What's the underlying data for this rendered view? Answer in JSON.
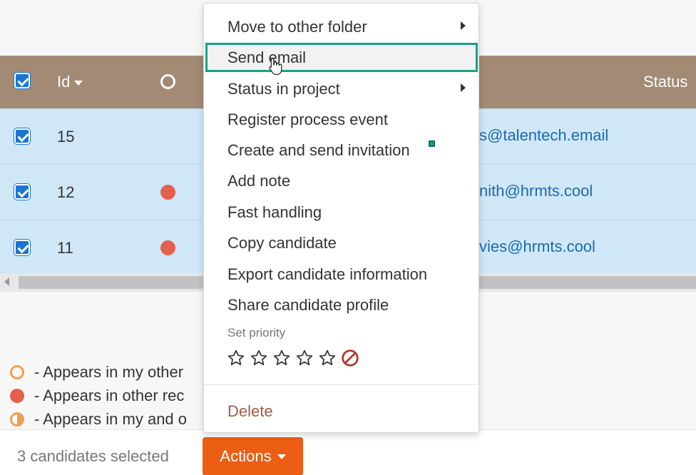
{
  "table": {
    "header": {
      "id_label": "Id",
      "status_label": "Status"
    },
    "rows": [
      {
        "id": "15",
        "email": "s@talentech.email",
        "has_dot": false
      },
      {
        "id": "12",
        "email": "nith@hrmts.cool",
        "has_dot": true
      },
      {
        "id": "11",
        "email": "vies@hrmts.cool",
        "has_dot": true
      }
    ]
  },
  "legend": {
    "items": [
      {
        "icon": "hollow-circle-icon",
        "text": "- Appears in my other"
      },
      {
        "icon": "filled-circle-icon",
        "text": "- Appears in other rec"
      },
      {
        "icon": "half-circle-icon",
        "text": "- Appears in my and o"
      }
    ]
  },
  "footer": {
    "selected_text": "3 candidates selected",
    "actions_label": "Actions"
  },
  "context_menu": {
    "items": [
      {
        "label": "Move to other folder",
        "has_submenu": true
      },
      {
        "label": "Send email",
        "has_submenu": false,
        "highlighted": true
      },
      {
        "label": "Status in project",
        "has_submenu": true
      },
      {
        "label": "Register process event",
        "has_submenu": false
      },
      {
        "label": "Create and send invitation",
        "has_submenu": false
      },
      {
        "label": "Add note",
        "has_submenu": false
      },
      {
        "label": "Fast handling",
        "has_submenu": false
      },
      {
        "label": "Copy candidate",
        "has_submenu": false
      },
      {
        "label": "Export candidate information",
        "has_submenu": false
      },
      {
        "label": "Share candidate profile",
        "has_submenu": false
      }
    ],
    "priority_label": "Set priority",
    "priority_stars": 5,
    "priority_value": 0,
    "delete_label": "Delete"
  },
  "colors": {
    "header_bg": "#a38a74",
    "selected_row_bg": "#cfe7f7",
    "accent_orange": "#eb5e14",
    "highlight_border": "#17a088",
    "dot_red": "#e4604c",
    "link_blue": "#1a6bb0",
    "delete_red": "#a25a4a"
  }
}
